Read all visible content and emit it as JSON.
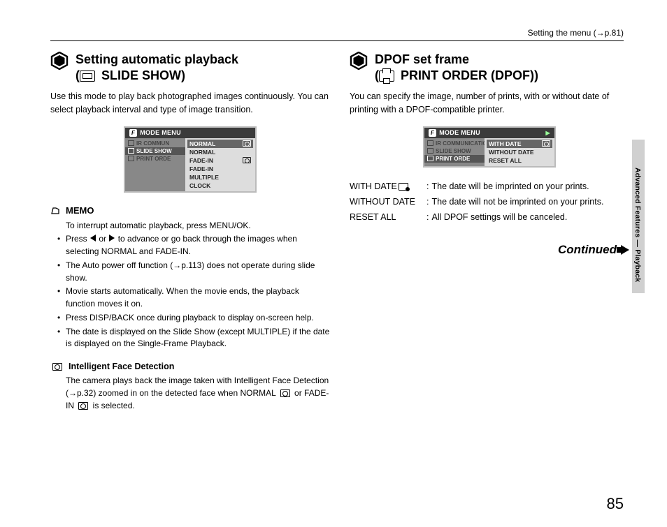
{
  "header": {
    "ref": "Setting the menu (→p.81)"
  },
  "left": {
    "title_line1": "Setting automatic playback",
    "title_line2_prefix": "(",
    "title_line2_label": " SLIDE SHOW)",
    "intro": "Use this mode to play back photographed images continuously. You can select playback interval and type of image transition.",
    "menu": {
      "header": "MODE MENU",
      "left_items": [
        "IR COMMUN",
        "SLIDE SHOW",
        "PRINT ORDE"
      ],
      "options": [
        "NORMAL",
        "NORMAL",
        "FADE-IN",
        "FADE-IN",
        "MULTIPLE",
        "CLOCK"
      ]
    },
    "memo_label": "MEMO",
    "memo_items": [
      "To interrupt automatic playback, press MENU/OK.",
      "Press  ◀ or ▶  to advance or go back through the images when selecting NORMAL and FADE-IN.",
      "The Auto power off function (→p.113) does not operate during slide show.",
      "Movie starts automatically. When the movie ends, the playback function moves it on.",
      "Press DISP/BACK once during playback to display on-screen help.",
      "The date is displayed on the Slide Show (except MULTIPLE) if the date is displayed on the Single-Frame Playback."
    ],
    "ifd_title": "Intelligent Face Detection",
    "ifd_body_pre": "The camera plays back the image taken with Intelligent Face Detection (→p.32) zoomed in on the detected face when NORMAL ",
    "ifd_body_mid": " or FADE-IN ",
    "ifd_body_post": " is selected."
  },
  "right": {
    "title_line1": "DPOF set frame",
    "title_line2_prefix": "(",
    "title_line2_label": " PRINT ORDER (DPOF))",
    "intro": "You can specify the image, number of prints, with or without date of printing with a DPOF-compatible printer.",
    "menu": {
      "header": "MODE MENU",
      "left_items": [
        "IR COMMUNICATION",
        "SLIDE SHOW",
        "PRINT ORDE"
      ],
      "options": [
        "WITH DATE",
        "WITHOUT DATE",
        "RESET ALL"
      ]
    },
    "defs": [
      {
        "term": "WITH DATE",
        "with_badge": true,
        "val": "The date will be imprinted on your prints."
      },
      {
        "term": "WITHOUT DATE",
        "with_badge": false,
        "val": "The date will not be imprinted on your prints."
      },
      {
        "term": "RESET ALL",
        "with_badge": false,
        "val": "All DPOF settings will be canceled."
      }
    ],
    "continued": "Continued"
  },
  "side_label": "Advanced Features — Playback",
  "page_number": "85"
}
